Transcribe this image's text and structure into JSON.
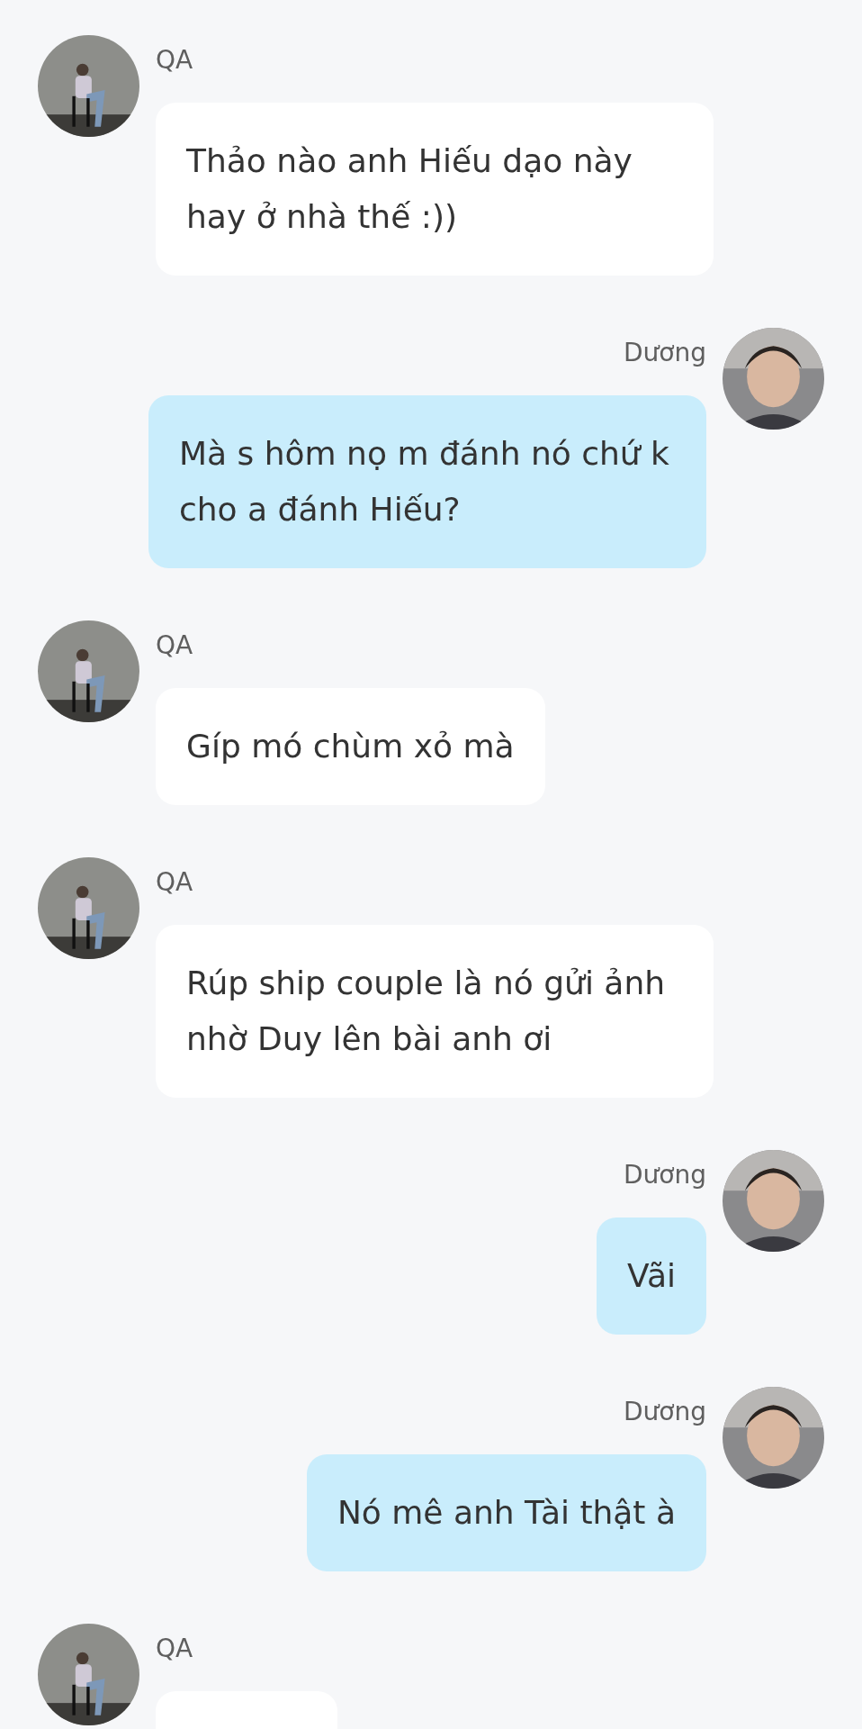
{
  "messages": [
    {
      "sender": "QA",
      "outgoing": false,
      "text": "Thảo nào anh Hiếu dạo này hay ở nhà thế :))"
    },
    {
      "sender": "Dương",
      "outgoing": true,
      "text": "Mà s hôm nọ m đánh nó chứ k cho a đánh Hiếu?"
    },
    {
      "sender": "QA",
      "outgoing": false,
      "text": "Gíp mó chùm xỏ mà"
    },
    {
      "sender": "QA",
      "outgoing": false,
      "text": "Rúp ship couple là nó gửi ảnh nhờ Duy lên bài anh ơi"
    },
    {
      "sender": "Dương",
      "outgoing": true,
      "text": "Vãi"
    },
    {
      "sender": "Dương",
      "outgoing": true,
      "text": "Nó mê anh Tài thật à"
    },
    {
      "sender": "QA",
      "outgoing": false
    }
  ]
}
